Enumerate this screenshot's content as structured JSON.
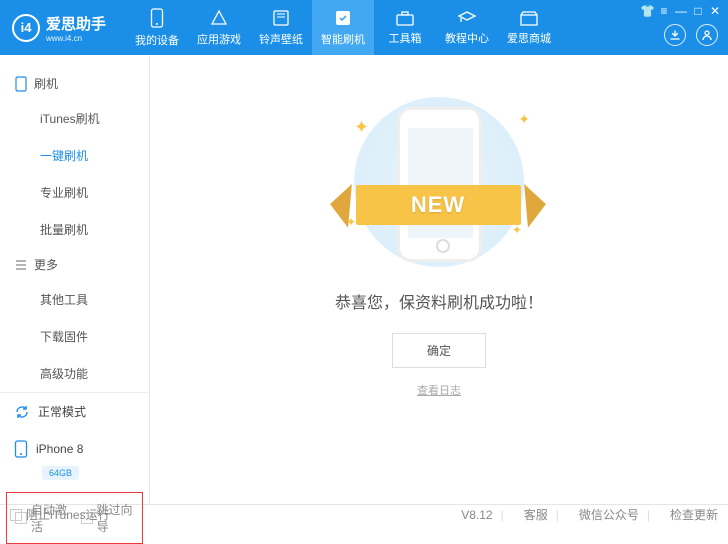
{
  "header": {
    "brand": "爱思助手",
    "subbrand": "www.i4.cn",
    "logo_letters": "i4",
    "tabs": [
      "我的设备",
      "应用游戏",
      "铃声壁纸",
      "智能刷机",
      "工具箱",
      "教程中心",
      "爱思商城"
    ]
  },
  "sidebar": {
    "g1": "刷机",
    "i1": "iTunes刷机",
    "i2": "一键刷机",
    "i3": "专业刷机",
    "i4": "批量刷机",
    "g2": "更多",
    "i5": "其他工具",
    "i6": "下载固件",
    "i7": "高级功能",
    "mode": "正常模式",
    "device": "iPhone 8",
    "storage": "64GB",
    "opt1": "自动激活",
    "opt2": "跳过向导"
  },
  "main": {
    "banner": "NEW",
    "msg": "恭喜您，保资料刷机成功啦！",
    "ok": "确定",
    "log": "查看日志"
  },
  "footer": {
    "c1": "阻止iTunes运行",
    "ver": "V8.12",
    "s": "客服",
    "w": "微信公众号",
    "u": "检查更新"
  }
}
